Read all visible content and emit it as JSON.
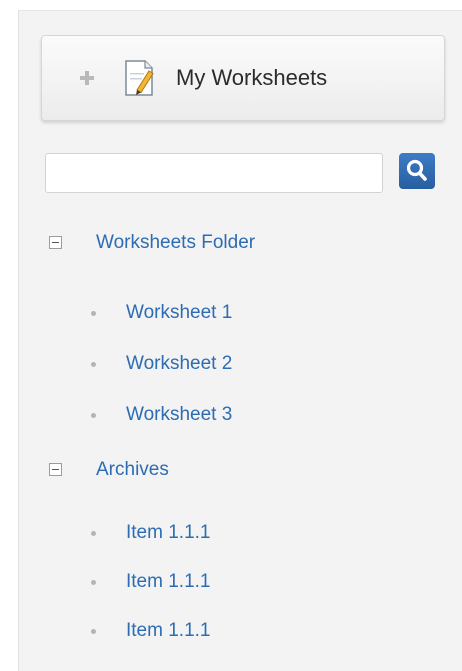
{
  "header": {
    "plus_icon": "plus-icon",
    "doc_icon": "document-edit-icon",
    "title": "My Worksheets"
  },
  "search": {
    "value": "",
    "placeholder": "",
    "button_icon": "search-icon"
  },
  "tree": {
    "folders": [
      {
        "label": "Worksheets Folder",
        "expanded": true,
        "items": [
          "Worksheet 1",
          "Worksheet 2",
          "Worksheet 3"
        ]
      },
      {
        "label": "Archives",
        "expanded": true,
        "items": [
          "Item 1.1.1",
          "Item 1.1.1",
          "Item 1.1.1"
        ]
      }
    ]
  },
  "colors": {
    "link": "#2d6cb3",
    "search_button": "#3471b9",
    "panel_background": "#f3f3f3"
  }
}
